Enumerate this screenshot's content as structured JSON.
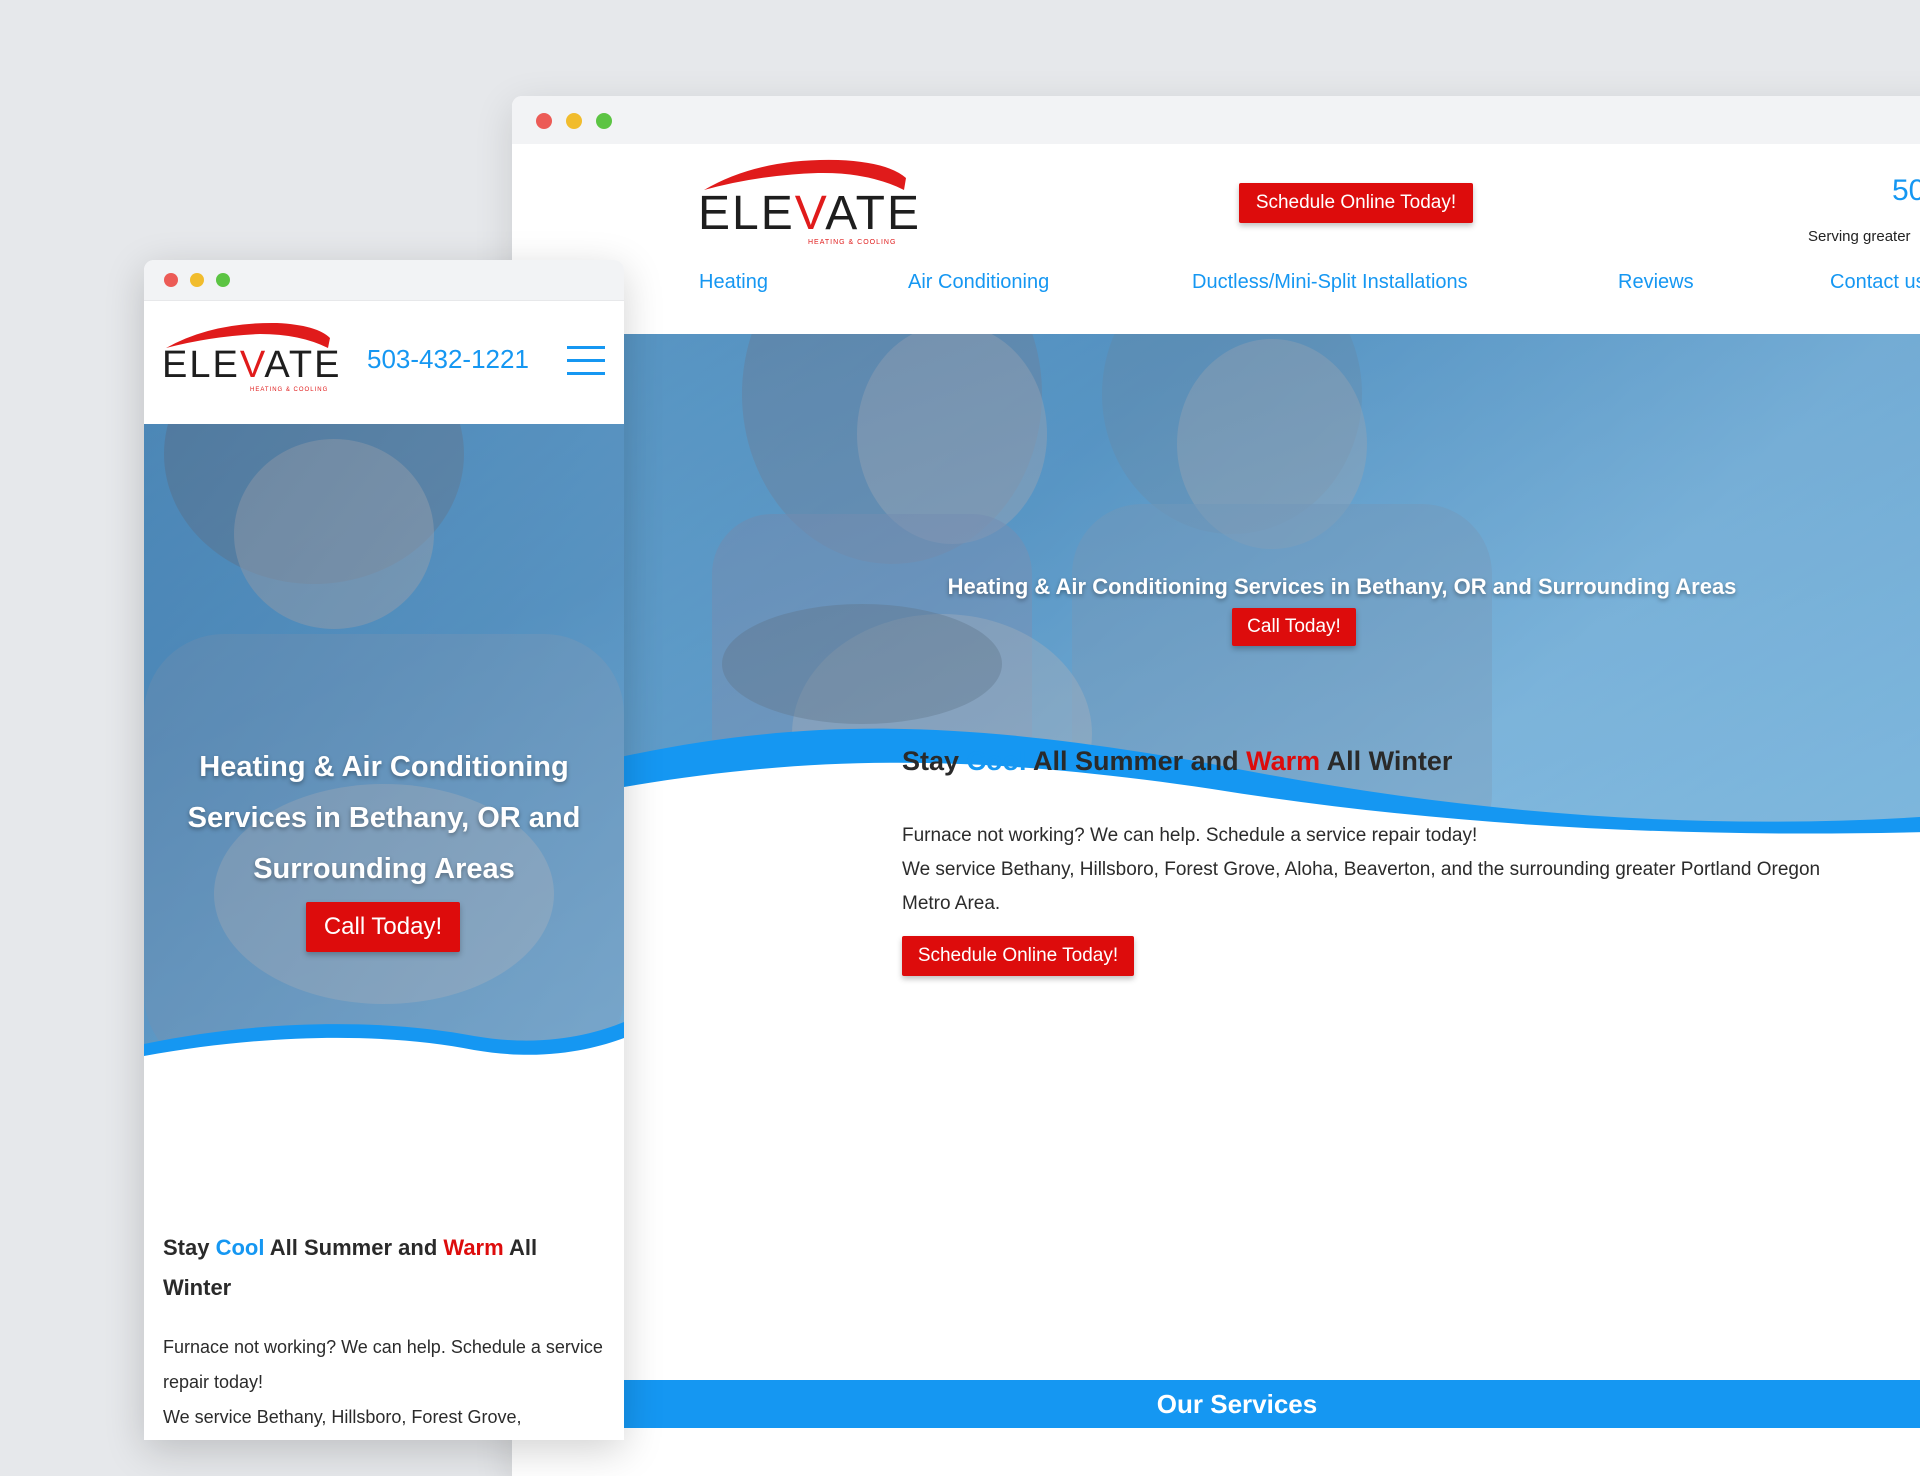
{
  "colors": {
    "accent_blue": "#1597f2",
    "cta_red": "#dd0c0c",
    "heading": "#2a2a2a",
    "background": "#e6e8eb"
  },
  "brand": {
    "logo_text_a": "ELE",
    "logo_text_v": "V",
    "logo_text_b": "ATE",
    "logo_sub": "HEATING & COOLING"
  },
  "desktop": {
    "header": {
      "schedule_label": "Schedule Online Today!",
      "phone": "50",
      "serving": "Serving greater"
    },
    "nav": [
      "Heating",
      "Air Conditioning",
      "Ductless/Mini-Split Installations",
      "Reviews",
      "Contact us"
    ],
    "hero": {
      "title": "Heating & Air Conditioning Services in Bethany, OR and Surrounding Areas",
      "cta_label": "Call Today!"
    },
    "intro": {
      "heading_a": "Stay ",
      "heading_cool": "Cool",
      "heading_b": " All Summer and ",
      "heading_warm": "Warm",
      "heading_c": " All Winter",
      "p1": "Furnace not working? We can help. Schedule a service repair today!",
      "p2": "We service Bethany, Hillsboro, Forest Grove, Aloha, Beaverton, and the surrounding greater Portland Oregon",
      "p3": "Metro Area.",
      "cta_label": "Schedule Online Today!"
    },
    "services_title": "Our Services"
  },
  "mobile": {
    "phone": "503-432-1221",
    "hero": {
      "title_1": "Heating & Air Conditioning",
      "title_2": "Services in Bethany, OR and",
      "title_3": "Surrounding Areas",
      "cta_label": "Call Today!"
    },
    "intro": {
      "heading_a": "Stay ",
      "heading_cool": "Cool",
      "heading_b": " All Summer and ",
      "heading_warm": "Warm",
      "heading_c": " All Winter",
      "p1": "Furnace not working? We can help. Schedule a service repair today!",
      "p2": "We service Bethany, Hillsboro, Forest Grove,"
    }
  }
}
